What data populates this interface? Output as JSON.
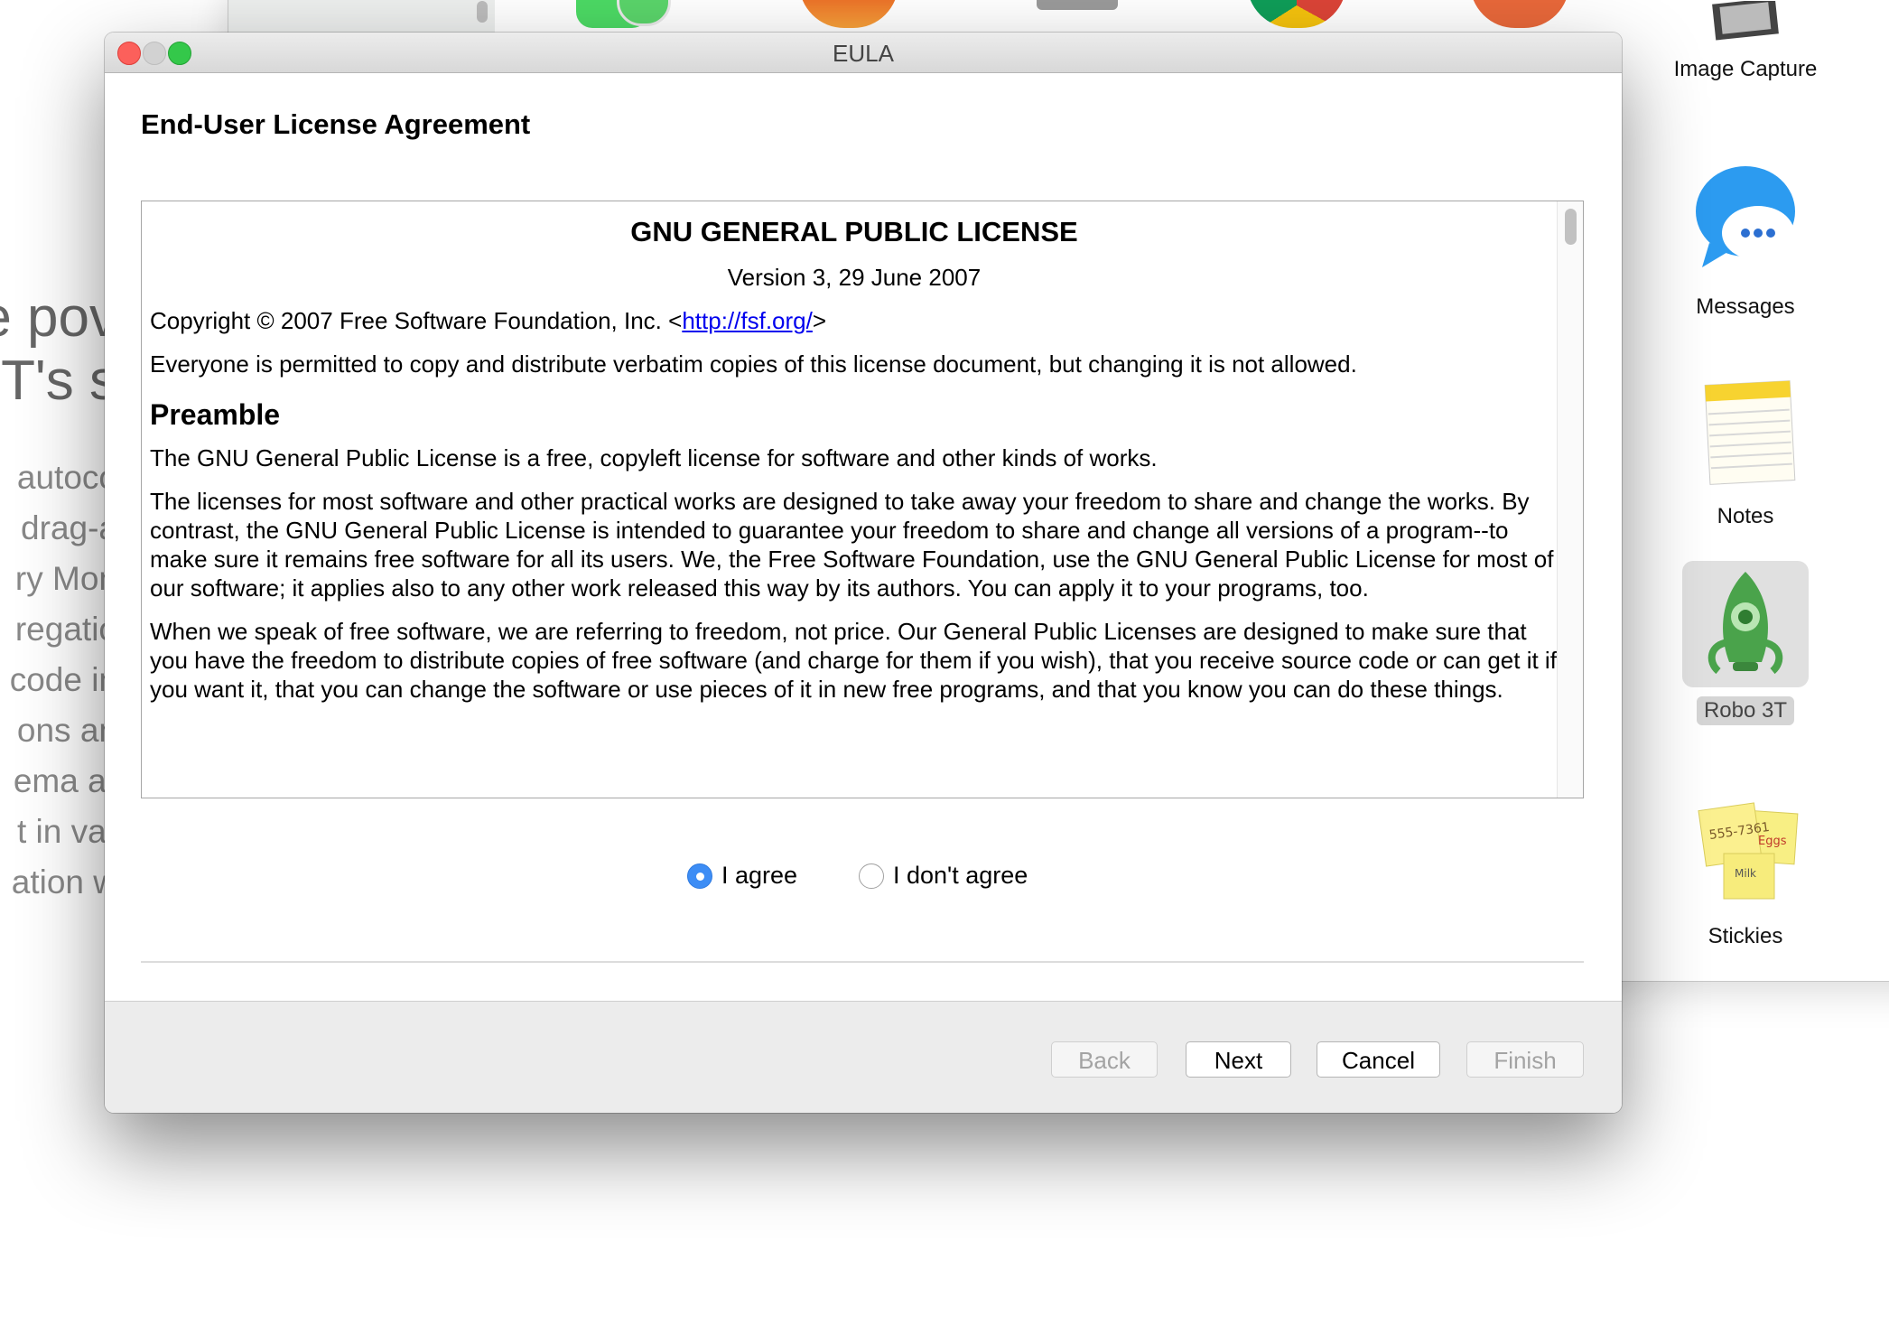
{
  "background_page": {
    "headline_fragments": [
      "e pov",
      "T's s"
    ],
    "body_fragments": [
      "autoco",
      "drag-a",
      "ry Mon",
      "regatio",
      "code in",
      "ons an",
      "ema ar",
      "t in var",
      "ation w"
    ]
  },
  "finder": {
    "apps": [
      {
        "label": "Image Capture",
        "icon": "image-capture-icon"
      },
      {
        "label": "Messages",
        "icon": "messages-icon"
      },
      {
        "label": "Notes",
        "icon": "notes-icon"
      },
      {
        "label": "Robo 3T",
        "icon": "robo3t-icon",
        "selected": true
      },
      {
        "label": "Stickies",
        "icon": "stickies-icon"
      }
    ]
  },
  "window": {
    "title": "EULA",
    "heading": "End-User License Agreement"
  },
  "license": {
    "title": "GNU GENERAL PUBLIC LICENSE",
    "version": "Version 3, 29 June 2007",
    "copyright_prefix": "Copyright © 2007 Free Software Foundation, Inc. <",
    "copyright_link": "http://fsf.org/",
    "copyright_suffix": ">",
    "permission": "Everyone is permitted to copy and distribute verbatim copies of this license document, but changing it is not allowed.",
    "preamble_heading": "Preamble",
    "paragraphs": [
      "The GNU General Public License is a free, copyleft license for software and other kinds of works.",
      "The licenses for most software and other practical works are designed to take away your freedom to share and change the works. By contrast, the GNU General Public License is intended to guarantee your freedom to share and change all versions of a program--to make sure it remains free software for all its users. We, the Free Software Foundation, use the GNU General Public License for most of our software; it applies also to any other work released this way by its authors. You can apply it to your programs, too.",
      "When we speak of free software, we are referring to freedom, not price. Our General Public Licenses are designed to make sure that you have the freedom to distribute copies of free software (and charge for them if you wish), that you receive source code or can get it if you want it, that you can change the software or use pieces of it in new free programs, and that you know you can do these things."
    ]
  },
  "agreement": {
    "agree_label": "I agree",
    "disagree_label": "I don't agree",
    "selected": "agree"
  },
  "buttons": {
    "back": "Back",
    "next": "Next",
    "cancel": "Cancel",
    "finish": "Finish"
  },
  "colors": {
    "radio_accent": "#3d8df5",
    "link": "#0000ee",
    "close": "#fc605b",
    "maximize": "#34c84a"
  }
}
